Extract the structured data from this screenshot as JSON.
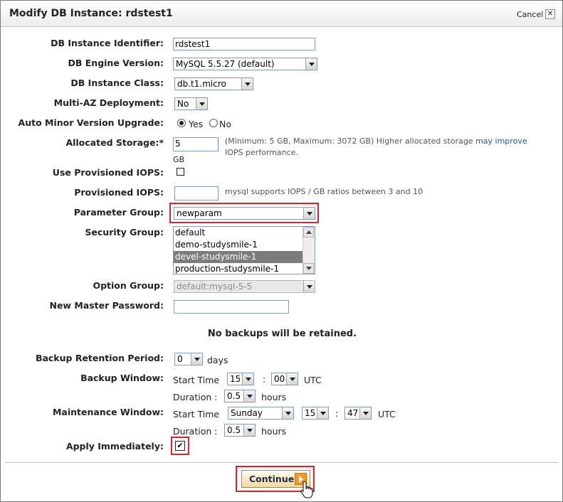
{
  "dialog": {
    "title": "Modify DB Instance: rdstest1",
    "cancel_label": "Cancel",
    "close_glyph": "✕"
  },
  "fields": {
    "identifier": {
      "label": "DB Instance Identifier:",
      "value": "rdstest1"
    },
    "engine_version": {
      "label": "DB Engine Version:",
      "value": "MySQL 5.5.27 (default)"
    },
    "instance_class": {
      "label": "DB Instance Class:",
      "value": "db.t1.micro"
    },
    "multi_az": {
      "label": "Multi-AZ Deployment:",
      "value": "No"
    },
    "auto_minor": {
      "label": "Auto Minor Version Upgrade:",
      "yes_label": "Yes",
      "no_label": "No",
      "selected": "Yes"
    },
    "allocated_storage": {
      "label": "Allocated Storage:*",
      "value": "5",
      "unit": "GB",
      "hint_before_link": "(Minimum: 5 GB, Maximum: 3072 GB) Higher allocated storage ",
      "hint_link": "may improve",
      "hint_after_link": "IOPS performance."
    },
    "use_piops": {
      "label": "Use Provisioned IOPS:",
      "checked": false
    },
    "provisioned_iops": {
      "label": "Provisioned IOPS:",
      "value": "",
      "hint": "mysql supports IOPS / GB ratios between 3 and 10"
    },
    "parameter_group": {
      "label": "Parameter Group:",
      "value": "newparam"
    },
    "security_group": {
      "label": "Security Group:",
      "options": [
        "default",
        "demo-studysmile-1",
        "devel-studysmile-1",
        "production-studysmile-1"
      ],
      "selected": "devel-studysmile-1"
    },
    "option_group": {
      "label": "Option Group:",
      "value": "default:mysql-5-5"
    },
    "master_password": {
      "label": "New Master Password:",
      "value": ""
    }
  },
  "backup": {
    "notice": "No backups will be retained.",
    "retention": {
      "label": "Backup Retention Period:",
      "value": "0",
      "unit": "days"
    },
    "window": {
      "label": "Backup Window:",
      "start_label": "Start Time",
      "hour": "15",
      "sep": ":",
      "minute": "00",
      "tz": "UTC",
      "duration_label": "Duration :",
      "duration": "0.5",
      "duration_unit": "hours"
    }
  },
  "maintenance": {
    "label": "Maintenance Window:",
    "start_label": "Start Time",
    "day": "Sunday",
    "hour": "15",
    "sep": ":",
    "minute": "47",
    "tz": "UTC",
    "duration_label": "Duration :",
    "duration": "0.5",
    "duration_unit": "hours"
  },
  "apply": {
    "label": "Apply Immediately:",
    "checked": true,
    "check_glyph": "✔"
  },
  "continue_label": "Continue",
  "highlight_color": "#d7252c"
}
